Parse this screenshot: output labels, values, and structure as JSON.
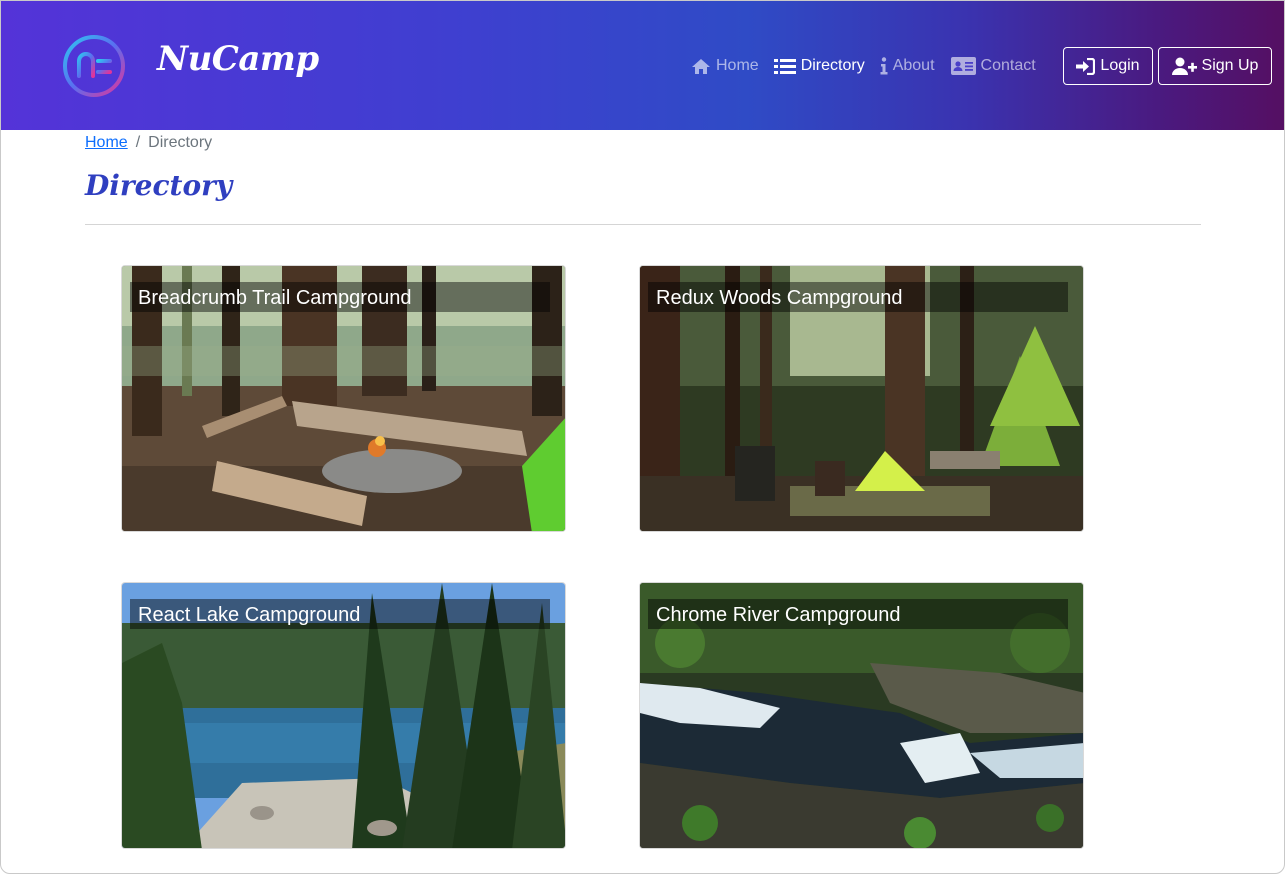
{
  "header": {
    "brand": "NuCamp",
    "nav": [
      {
        "label": "Home",
        "icon": "home-icon",
        "active": false
      },
      {
        "label": "Directory",
        "icon": "list-icon",
        "active": true
      },
      {
        "label": "About",
        "icon": "info-icon",
        "active": false
      },
      {
        "label": "Contact",
        "icon": "address-card-icon",
        "active": false
      }
    ],
    "login_label": "Login",
    "signup_label": "Sign Up"
  },
  "breadcrumb": {
    "home": "Home",
    "separator": "/",
    "current": "Directory"
  },
  "page_title": "Directory",
  "campsites": [
    {
      "name": "Breadcrumb Trail Campground"
    },
    {
      "name": "Redux Woods Campground"
    },
    {
      "name": "React Lake Campground"
    },
    {
      "name": "Chrome River Campground"
    }
  ],
  "colors": {
    "gradient_start": "#5433d8",
    "gradient_end": "#550f62",
    "title_blue": "#2f3fc0",
    "link_blue": "#0d6efd"
  }
}
